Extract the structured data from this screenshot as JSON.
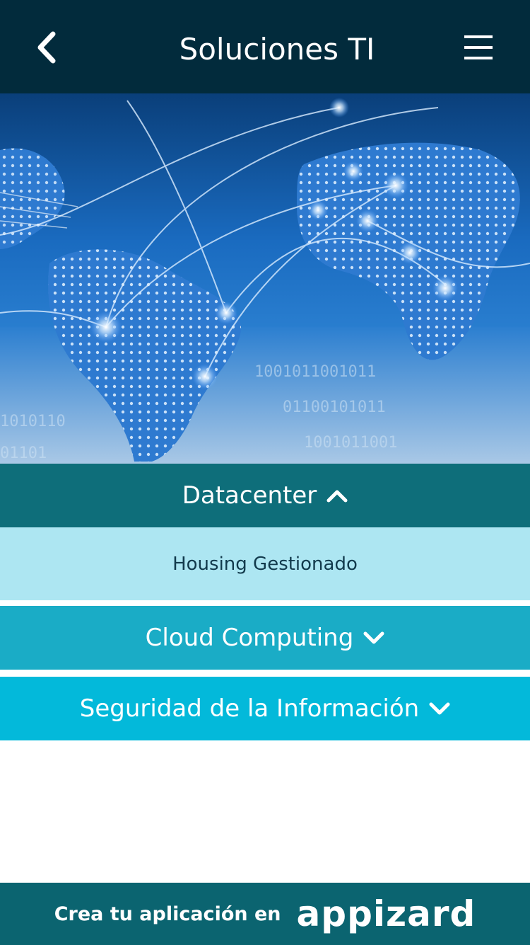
{
  "header": {
    "title": "Soluciones TI",
    "back_icon": "chevron-left-icon",
    "menu_icon": "hamburger-menu-icon",
    "background": "#022b3c"
  },
  "hero": {
    "image": "world-map-network-image"
  },
  "sections": [
    {
      "label": "Datacenter",
      "expanded": true,
      "chevron_icon": "chevron-up-icon",
      "color": "#0e6e7a",
      "items": [
        {
          "label": "Housing Gestionado",
          "color": "#ade6f2"
        }
      ]
    },
    {
      "label": "Cloud Computing",
      "expanded": false,
      "chevron_icon": "chevron-down-icon",
      "color": "#1aacc6"
    },
    {
      "label": "Seguridad de la Información",
      "expanded": false,
      "chevron_icon": "chevron-down-icon",
      "color": "#03b9da"
    }
  ],
  "footer": {
    "text": "Crea tu aplicación en",
    "brand": "appizard",
    "background": "#0b6470"
  }
}
